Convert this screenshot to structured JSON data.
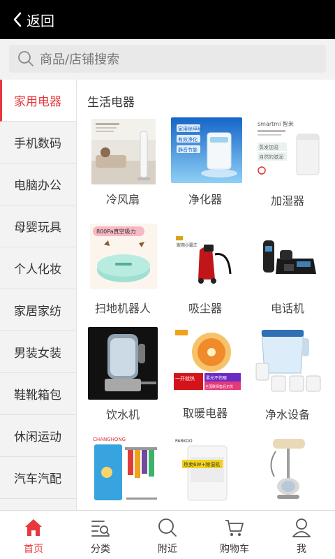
{
  "header": {
    "back_label": "返回"
  },
  "search": {
    "placeholder": "商品/店铺搜索"
  },
  "sidebar": {
    "items": [
      {
        "label": "家用电器",
        "active": true
      },
      {
        "label": "手机数码"
      },
      {
        "label": "电脑办公"
      },
      {
        "label": "母婴玩具"
      },
      {
        "label": "个人化妆"
      },
      {
        "label": "家居家纺"
      },
      {
        "label": "男装女装"
      },
      {
        "label": "鞋靴箱包"
      },
      {
        "label": "休闲运动"
      },
      {
        "label": "汽车汽配"
      }
    ]
  },
  "main": {
    "section_title": "生活电器",
    "products": [
      {
        "label": "冷风扇",
        "icon": "tower-fan-image"
      },
      {
        "label": "净化器",
        "icon": "air-purifier-image",
        "image_text": [
          "家用除甲醛",
          "有效净化",
          "静音节能"
        ]
      },
      {
        "label": "加湿器",
        "icon": "humidifier-image",
        "image_text": [
          "smartmi 智米",
          "蒸发加湿",
          "自然的滋润"
        ]
      },
      {
        "label": "扫地机器人",
        "icon": "robot-vacuum-image",
        "image_text": [
          "800Pa真空吸力"
        ]
      },
      {
        "label": "吸尘器",
        "icon": "vacuum-cleaner-image",
        "image_text": [
          "家用小霸王"
        ]
      },
      {
        "label": "电话机",
        "icon": "telephone-image"
      },
      {
        "label": "饮水机",
        "icon": "water-dispenser-image"
      },
      {
        "label": "取暖电器",
        "icon": "heater-image",
        "image_text": [
          "一开就热",
          "柔光不伤眼",
          "全国联保售后无忧"
        ]
      },
      {
        "label": "净水设备",
        "icon": "water-filter-image"
      },
      {
        "label": "",
        "icon": "clothes-dryer-image",
        "image_text": [
          "CHANGHONG"
        ]
      },
      {
        "label": "",
        "icon": "dehumidifier-image",
        "image_text": [
          "PARKOO",
          "热卖6W+除湿机"
        ]
      },
      {
        "label": "",
        "icon": "garment-steamer-image"
      }
    ]
  },
  "tabbar": {
    "items": [
      {
        "label": "首页",
        "icon": "home-icon",
        "active": true
      },
      {
        "label": "分类",
        "icon": "category-icon"
      },
      {
        "label": "附近",
        "icon": "search-icon"
      },
      {
        "label": "购物车",
        "icon": "cart-icon"
      },
      {
        "label": "我",
        "icon": "user-icon"
      }
    ]
  },
  "colors": {
    "accent": "#e8383d",
    "topbar": "#000000",
    "sidebar_bg": "#f3f3f3"
  }
}
